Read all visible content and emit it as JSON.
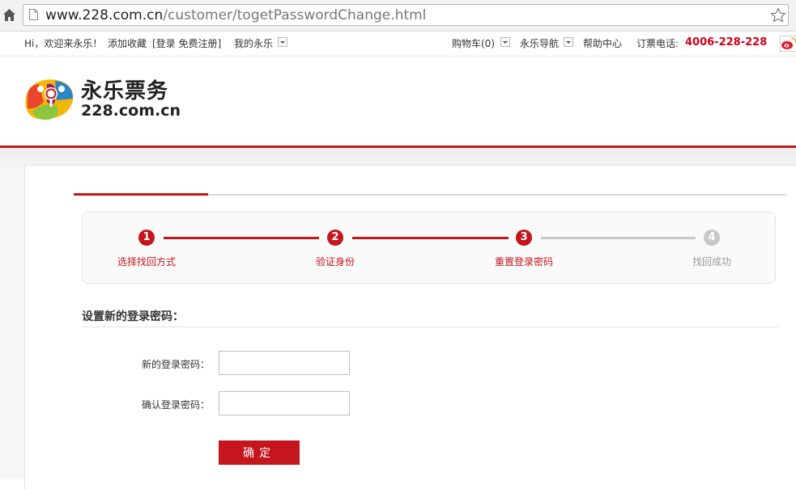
{
  "browser": {
    "url_host": "www.228.com.cn",
    "url_path": "/customer/togetPasswordChange.html"
  },
  "topbar": {
    "greeting": "Hi，欢迎来永乐！",
    "bookmark": "添加收藏",
    "login_register": "[登录 免费注册]",
    "my_yongle": "我的永乐",
    "cart": "购物车(0)",
    "nav": "永乐导航",
    "help": "帮助中心",
    "hotline_label": "订票电话:",
    "hotline": "4006-228-228"
  },
  "logo": {
    "name_cn": "永乐票务",
    "name_en": "228.com.cn"
  },
  "steps": [
    {
      "num": "1",
      "label": "选择找回方式",
      "state": "done"
    },
    {
      "num": "2",
      "label": "验证身份",
      "state": "done"
    },
    {
      "num": "3",
      "label": "重置登录密码",
      "state": "current"
    },
    {
      "num": "4",
      "label": "找回成功",
      "state": "pending"
    }
  ],
  "form": {
    "title": "设置新的登录密码：",
    "new_password_label": "新的登录密码：",
    "new_password_value": "",
    "confirm_password_label": "确认登录密码：",
    "confirm_password_value": "",
    "submit_label": "确定"
  },
  "colors": {
    "brand_red": "#c4161c",
    "pending_grey": "#c8c8c8"
  }
}
